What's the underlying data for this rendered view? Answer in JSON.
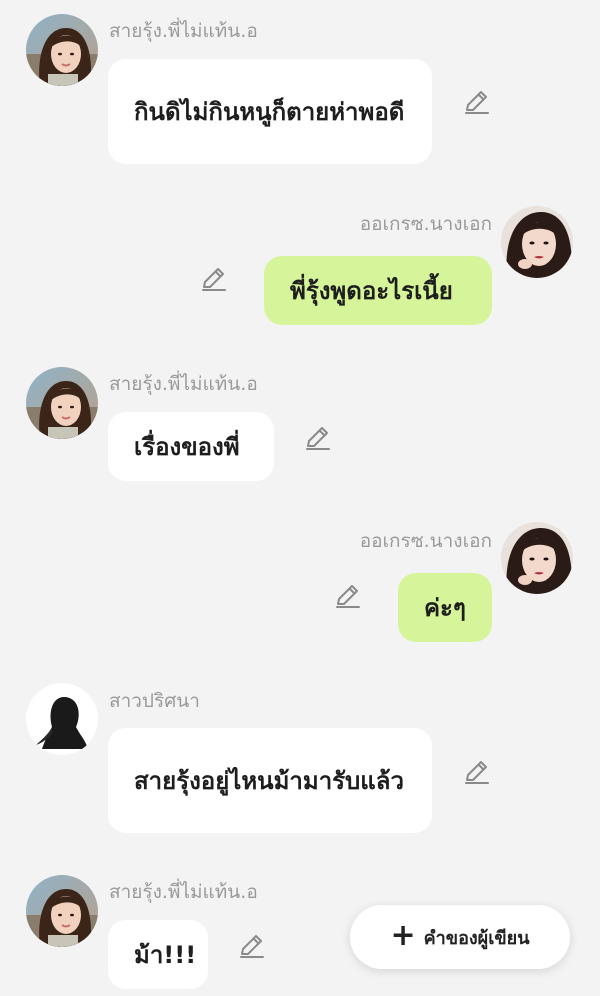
{
  "colors": {
    "background": "#f3f3f4",
    "bubble_incoming": "#ffffff",
    "bubble_outgoing": "#d6f59a",
    "name_text": "#9a9a9a",
    "message_text": "#1e1e1e"
  },
  "messages": [
    {
      "sender": "สายรุ้ง.พี่ไม่แท้น.อ",
      "text": "กินดิไม่กินหนูก็ตายห่าพอดี",
      "side": "left",
      "avatar": "girl-selfie-avatar"
    },
    {
      "sender": "ออเกรซ.นางเอก",
      "text": "พี่รุ้งพูดอะไรเนี้ย",
      "side": "right",
      "avatar": "girl-makeup-avatar"
    },
    {
      "sender": "สายรุ้ง.พี่ไม่แท้น.อ",
      "text": "เรื่องของพี่",
      "side": "left",
      "avatar": "girl-selfie-avatar"
    },
    {
      "sender": "ออเกรซ.นางเอก",
      "text": "ค่ะๆ",
      "side": "right",
      "avatar": "girl-makeup-avatar"
    },
    {
      "sender": "สาวปริศนา",
      "text": "สายรุ้งอยู่ไหนม้ามารับแล้ว",
      "side": "left",
      "avatar": "silhouette-avatar"
    },
    {
      "sender": "สายรุ้ง.พี่ไม่แท้น.อ",
      "text": "ม้า!!!",
      "side": "left",
      "avatar": "girl-selfie-avatar"
    }
  ],
  "writer_button": {
    "icon": "plus-icon",
    "label": "คำของผู้เขียน"
  }
}
